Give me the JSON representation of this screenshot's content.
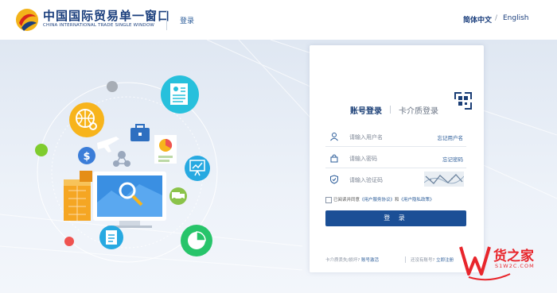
{
  "header": {
    "logo_cn": "中国国际贸易单一窗口",
    "logo_en": "CHINA INTERNATIONAL TRADE SINGLE WINDOW",
    "login_link": "登录",
    "lang_cn": "简体中文",
    "lang_sep": "/",
    "lang_en": "English"
  },
  "login": {
    "tab_account": "账号登录",
    "tab_card": "卡介质登录",
    "username_placeholder": "请输入用户名",
    "forgot_username": "忘记用户名",
    "password_placeholder": "请输入密码",
    "forgot_password": "忘记密码",
    "captcha_placeholder": "请输入验证码",
    "agree_prefix": "已阅读并同意",
    "agree_link1": "《用户服务协议》",
    "agree_and": "和",
    "agree_link2": "《用户隐私政策》",
    "submit": "登 录",
    "footer_left_text": "卡介质丢失/损坏?",
    "footer_left_link": "账号激活",
    "footer_right_text": "还没有账号?",
    "footer_right_link": "立即注册"
  },
  "watermark": {
    "text": "货之家",
    "sub": "S1W2C.COM"
  },
  "colors": {
    "brand": "#1b3f7d",
    "button": "#1b4f96",
    "link": "#2b5c99"
  }
}
